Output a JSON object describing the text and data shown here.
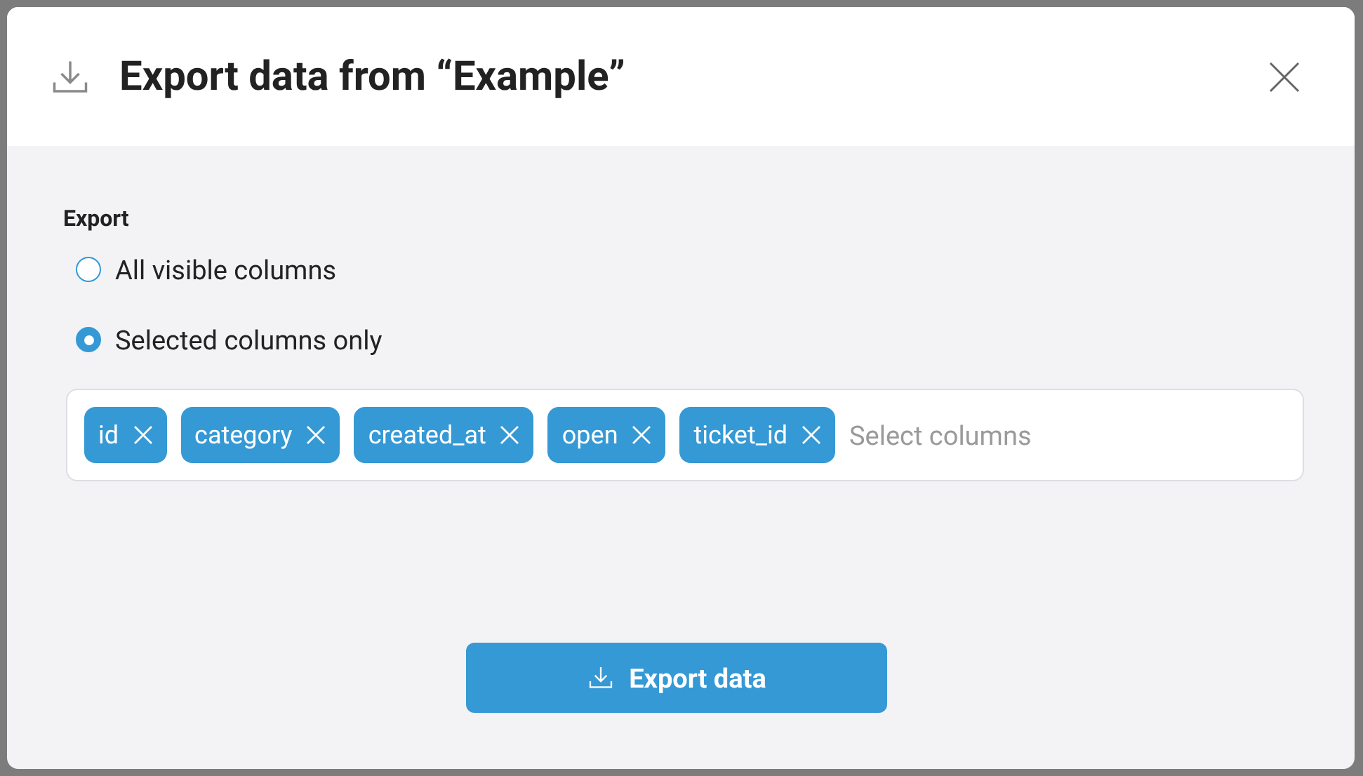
{
  "dialog": {
    "title": "Export data from “Example”",
    "section_label": "Export",
    "options": [
      {
        "label": "All visible columns",
        "selected": false
      },
      {
        "label": "Selected columns only",
        "selected": true
      }
    ],
    "columns_field": {
      "tags": [
        "id",
        "category",
        "created_at",
        "open",
        "ticket_id"
      ],
      "placeholder": "Select columns"
    },
    "button": "Export data"
  }
}
